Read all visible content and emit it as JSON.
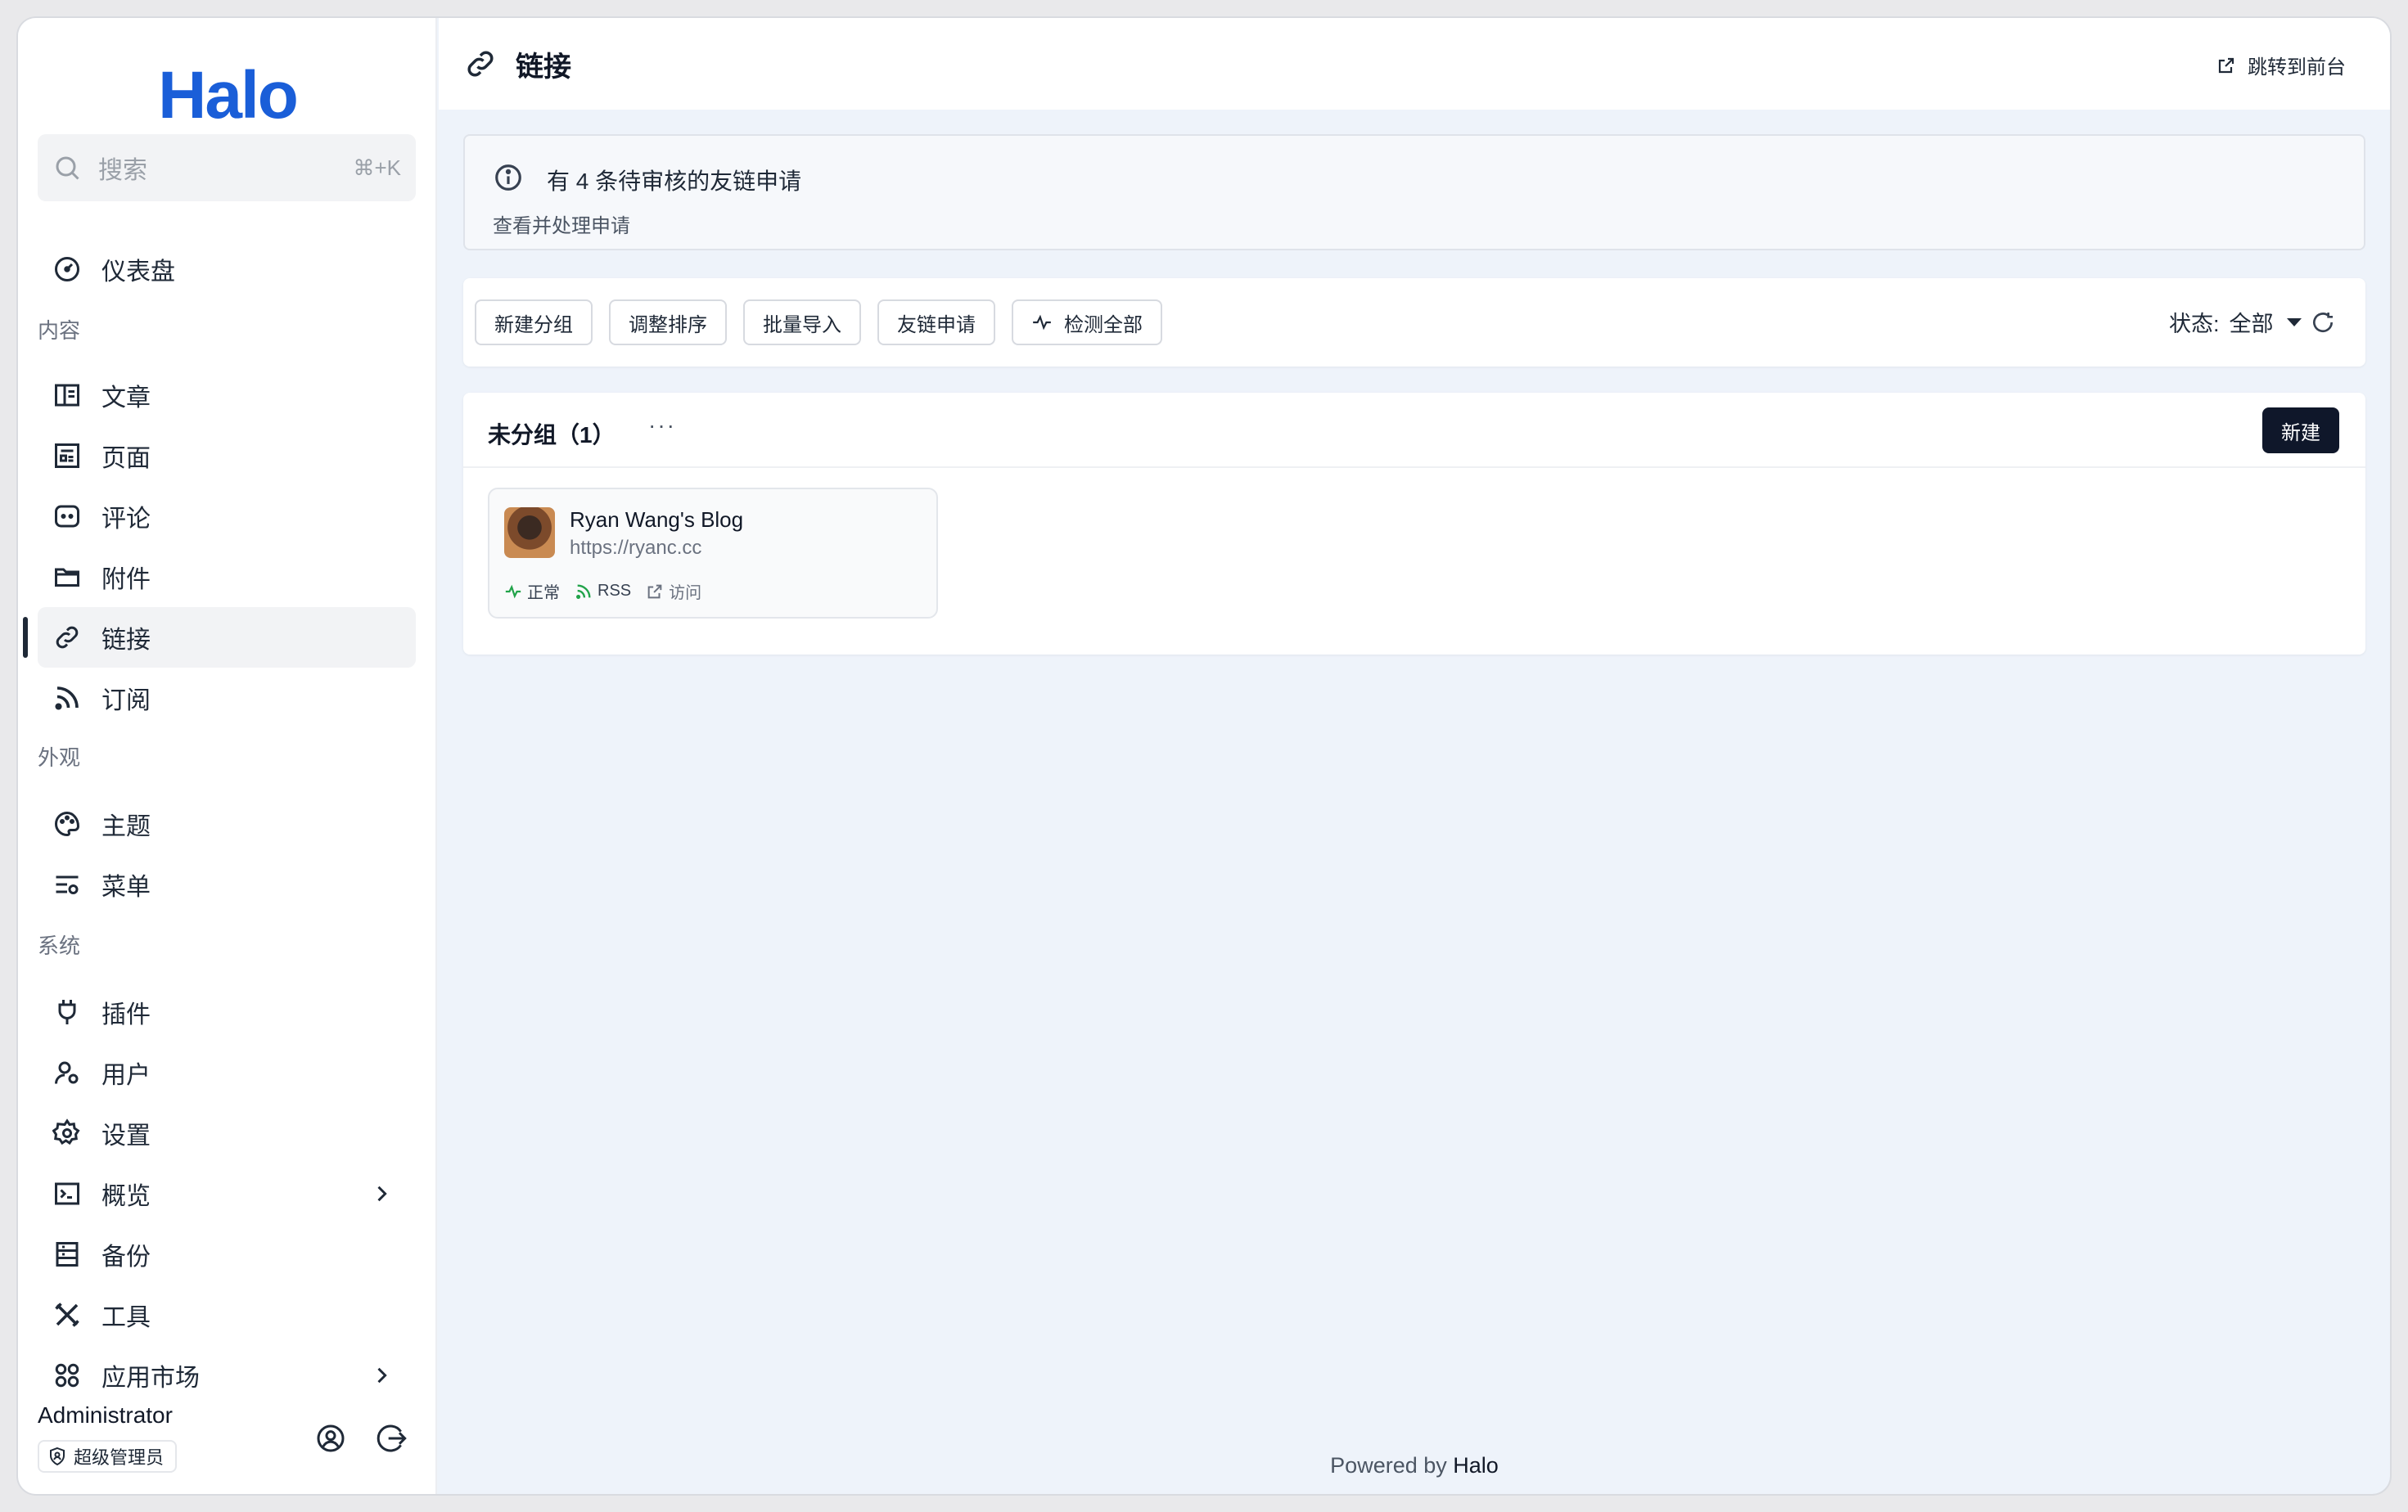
{
  "sidebar": {
    "logo": "Halo",
    "search": {
      "placeholder": "搜索",
      "shortcut": "⌘+K"
    },
    "dashboard": "仪表盘",
    "sections": {
      "content": "内容",
      "appearance": "外观",
      "system": "系统"
    },
    "content_items": [
      "文章",
      "页面",
      "评论",
      "附件",
      "链接",
      "订阅"
    ],
    "appearance_items": [
      "主题",
      "菜单"
    ],
    "system_items": [
      "插件",
      "用户",
      "设置",
      "概览",
      "备份",
      "工具",
      "应用市场"
    ],
    "active_item": "链接",
    "user": {
      "name": "Administrator",
      "role": "超级管理员"
    }
  },
  "header": {
    "title": "链接",
    "jump_label": "跳转到前台"
  },
  "alert": {
    "title": "有 4 条待审核的友链申请",
    "description": "查看并处理申请"
  },
  "toolbar": {
    "buttons": [
      "新建分组",
      "调整排序",
      "批量导入",
      "友链申请",
      "检测全部"
    ],
    "status_label": "状态:",
    "status_value": "全部"
  },
  "group": {
    "title": "未分组（1）",
    "more": "···",
    "new_button": "新建",
    "links": [
      {
        "name": "Ryan Wang's Blog",
        "url": "https://ryanc.cc",
        "status": "正常",
        "rss": "RSS",
        "visit": "访问"
      }
    ]
  },
  "footer": {
    "prefix": "Powered by",
    "brand": "Halo"
  },
  "colors": {
    "brand": "#1a5ed8",
    "primary_button": "#0f172a",
    "status_ok": "#22a34a",
    "background": "#eef3fa"
  }
}
